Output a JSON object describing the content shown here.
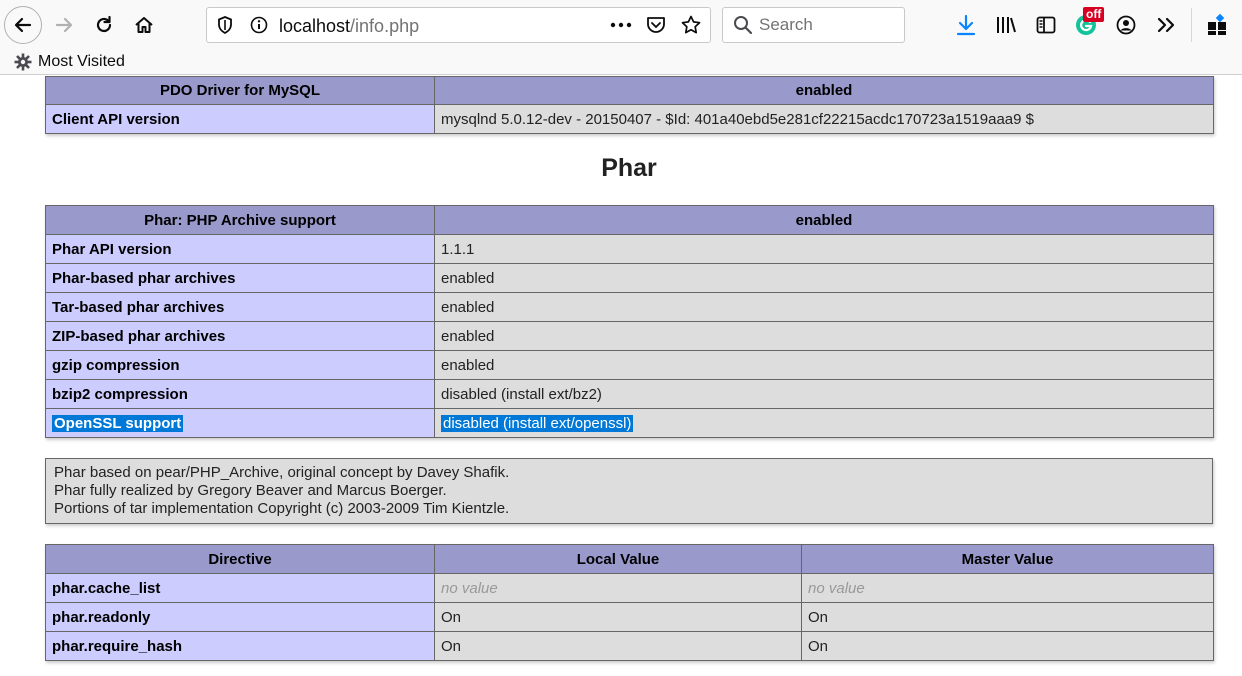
{
  "browser": {
    "url_host": "localhost",
    "url_path": "/info.php",
    "search_placeholder": "Search",
    "addon_badge": "off",
    "bookmarks": [
      "Most Visited"
    ],
    "icons": [
      "back-arrow-icon",
      "forward-arrow-icon",
      "reload-icon",
      "home-icon",
      "shield-icon",
      "info-icon",
      "more-icon",
      "pocket-icon",
      "star-icon",
      "search-icon",
      "download-icon",
      "library-icon",
      "sidebar-icon",
      "grammarly-icon",
      "account-icon",
      "overflow-icon",
      "extension-icon",
      "gear-icon"
    ]
  },
  "pdo_table": {
    "header": [
      "PDO Driver for MySQL",
      "enabled"
    ],
    "rows": [
      [
        "Client API version",
        "mysqlnd 5.0.12-dev - 20150407 - $Id: 401a40ebd5e281cf22215acdc170723a1519aaa9 $"
      ]
    ]
  },
  "phar": {
    "title": "Phar",
    "header": [
      "Phar: PHP Archive support",
      "enabled"
    ],
    "rows": [
      [
        "Phar API version",
        "1.1.1"
      ],
      [
        "Phar-based phar archives",
        "enabled"
      ],
      [
        "Tar-based phar archives",
        "enabled"
      ],
      [
        "ZIP-based phar archives",
        "enabled"
      ],
      [
        "gzip compression",
        "enabled"
      ],
      [
        "bzip2 compression",
        "disabled (install ext/bz2)"
      ],
      [
        "OpenSSL support",
        "disabled (install ext/openssl)"
      ]
    ],
    "credits": [
      "Phar based on pear/PHP_Archive, original concept by Davey Shafik.",
      "Phar fully realized by Gregory Beaver and Marcus Boerger.",
      "Portions of tar implementation Copyright (c) 2003-2009 Tim Kientzle."
    ]
  },
  "directives": {
    "header": [
      "Directive",
      "Local Value",
      "Master Value"
    ],
    "rows": [
      [
        "phar.cache_list",
        "no value",
        "no value"
      ],
      [
        "phar.readonly",
        "On",
        "On"
      ],
      [
        "phar.require_hash",
        "On",
        "On"
      ]
    ]
  },
  "colors": {
    "header_bg": "#9999cc",
    "key_bg": "#ccccff",
    "value_bg": "#dddddd",
    "selection": "#0078d7",
    "download_icon": "#0a84ff",
    "badge": "#d70022"
  }
}
